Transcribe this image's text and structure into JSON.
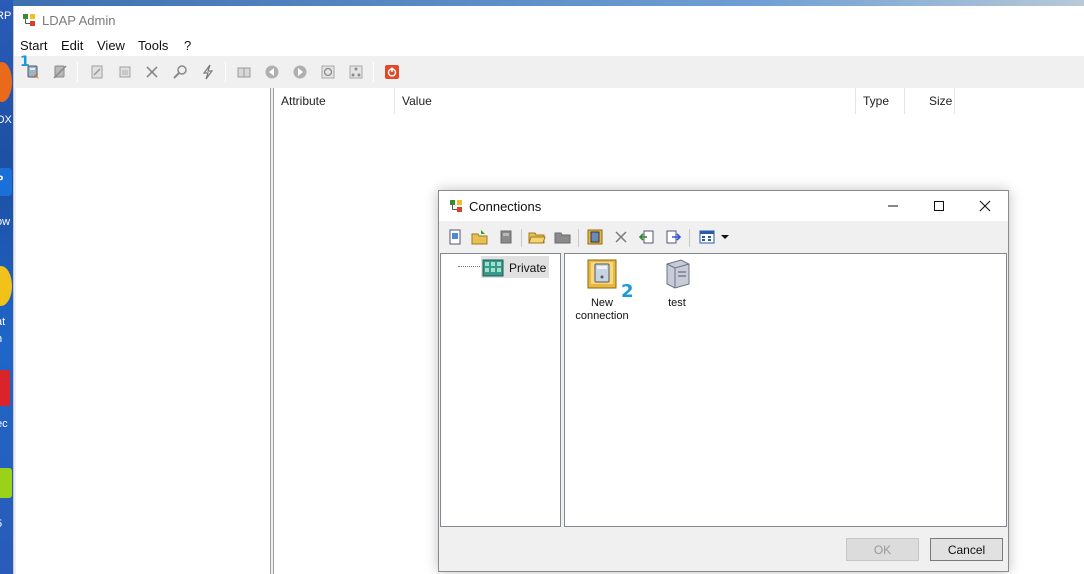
{
  "window": {
    "title": "LDAP Admin"
  },
  "menu": {
    "items": [
      "Start",
      "Edit",
      "View",
      "Tools",
      "?"
    ]
  },
  "toolbar_icons": [
    "connect-icon",
    "disconnect-icon",
    "edit-icon",
    "properties-icon",
    "delete-icon",
    "search-icon",
    "lightning-icon",
    "book-icon",
    "back-icon",
    "forward-icon",
    "refresh-icon",
    "schema-icon",
    "exit-icon"
  ],
  "attributes_table": {
    "columns": [
      "Attribute",
      "Value",
      "Type",
      "Size"
    ]
  },
  "annotations": {
    "marker_1": "1",
    "marker_2": "2"
  },
  "desktop_fragments": [
    "RP",
    "OX",
    "P",
    "ow",
    "at",
    "n",
    "ec",
    "5"
  ],
  "connections_dialog": {
    "title": "Connections",
    "tree": {
      "root": "Private"
    },
    "list_items": [
      {
        "label_line1": "New",
        "label_line2": "connection",
        "icon": "new-connection-icon"
      },
      {
        "label_line1": "test",
        "label_line2": "",
        "icon": "server-icon"
      }
    ],
    "buttons": {
      "ok": "OK",
      "cancel": "Cancel"
    }
  },
  "colors": {
    "accent_marker": "#1a9ad6",
    "exit_button": "#e04a2a",
    "desktop": "#1d4fa3"
  }
}
